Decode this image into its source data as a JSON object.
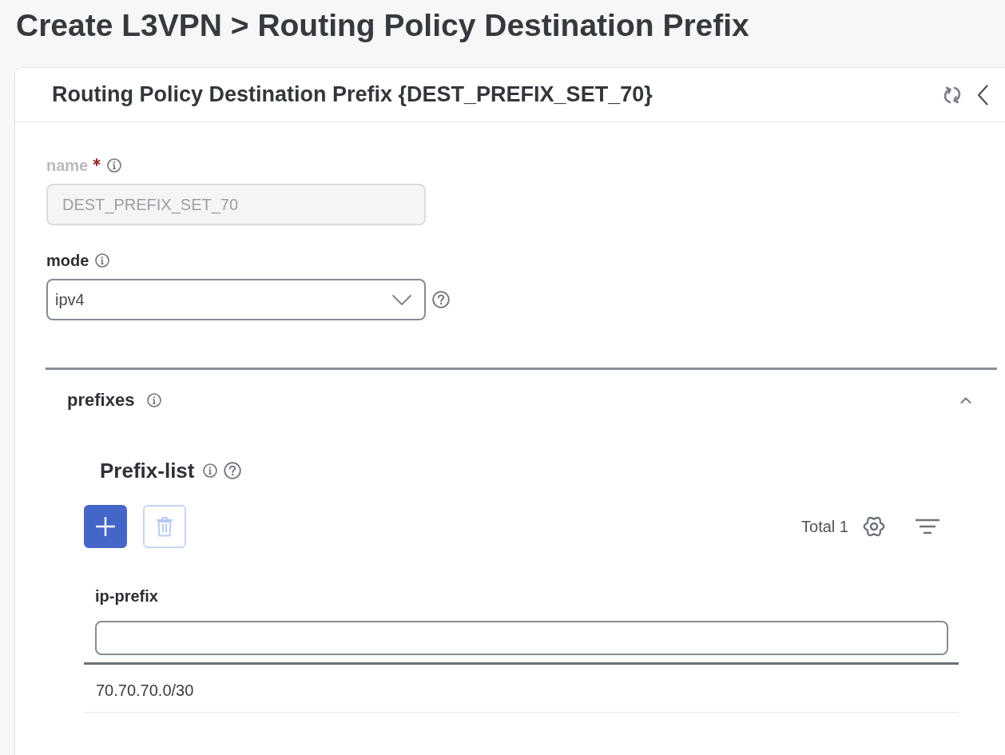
{
  "page": {
    "title": "Create L3VPN > Routing Policy Destination Prefix"
  },
  "card": {
    "title": "Routing Policy Destination Prefix {DEST_PREFIX_SET_70}"
  },
  "fields": [
    {
      "kind": "text",
      "label": "name",
      "required": true,
      "disabled": true,
      "help": false,
      "value": "DEST_PREFIX_SET_70"
    },
    {
      "kind": "select",
      "label": "mode",
      "required": false,
      "disabled": false,
      "help": true,
      "value": "ipv4"
    }
  ],
  "section": {
    "title": "prefixes",
    "expanded": true,
    "list": {
      "title": "Prefix-list",
      "actions": [
        {
          "kind": "add",
          "disabled": false
        },
        {
          "kind": "delete",
          "disabled": true
        }
      ],
      "total": "Total 1",
      "columns": [
        {
          "label": "ip-prefix"
        }
      ],
      "rows": [
        {
          "cells": [
            "70.70.70.0/30"
          ]
        }
      ]
    }
  }
}
